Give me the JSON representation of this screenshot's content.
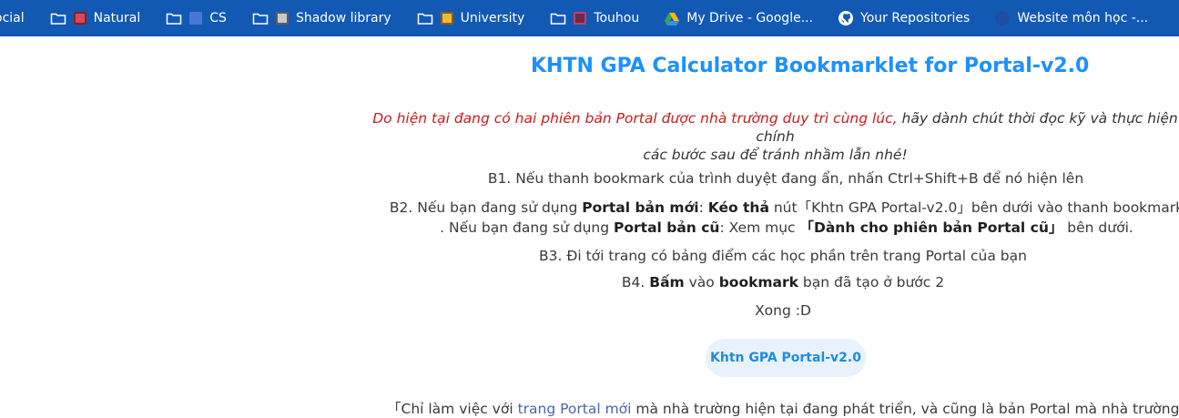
{
  "bookmarks": [
    {
      "label": "ocial",
      "icon": "none"
    },
    {
      "label": "Natural",
      "icon": "folder-icon"
    },
    {
      "label": "CS",
      "icon": "folder-icon"
    },
    {
      "label": "Shadow library",
      "icon": "folder-icon"
    },
    {
      "label": "University",
      "icon": "folder-icon"
    },
    {
      "label": "Touhou",
      "icon": "folder-icon"
    },
    {
      "label": "My Drive - Google...",
      "icon": "google-drive-icon"
    },
    {
      "label": "Your Repositories",
      "icon": "github-icon"
    },
    {
      "label": "Website môn học -...",
      "icon": "website-icon"
    }
  ],
  "page": {
    "title": "KHTN GPA Calculator Bookmarklet for Portal-v2.0",
    "notice_red": "Do hiện tại đang có hai phiên bản Portal được nhà trường duy trì cùng lúc,",
    "notice_rest": " hãy dành chút thời đọc kỹ và thực hiện chính",
    "notice_line2": "các bước sau để tránh nhầm lẫn nhé!",
    "step1": "B1. Nếu thanh bookmark của trình duyệt đang ẩn, nhấn Ctrl+Shift+B để nó hiện lên",
    "step2_prefix": "B2. Nếu bạn đang sử dụng ",
    "step2_bold1": "Portal bản mới",
    "step2_mid1": ": ",
    "step2_bold2": "Kéo thả",
    "step2_mid2": " nút「Khtn GPA Portal-v2.0」bên dưới vào thanh bookmark",
    "step2b_prefix": ". Nếu bạn đang sử dụng ",
    "step2b_bold1": "Portal bản cũ",
    "step2b_mid": ": Xem mục ",
    "step2b_bold2": "「Dành cho phiên bản Portal cũ」",
    "step2b_suffix": " bên dưới.",
    "step3": "B3. Đi tới trang có bảng điểm các học phần trên trang Portal của bạn",
    "step4_prefix": "B4. ",
    "step4_bold1": "Bấm",
    "step4_mid": " vào ",
    "step4_bold2": "bookmark",
    "step4_suffix": " bạn đã tạo ở bước 2",
    "done": "Xong :D",
    "button_label": "Khtn GPA Portal-v2.0",
    "footer_prefix": "「Chỉ làm việc với ",
    "footer_link": "trang Portal mới",
    "footer_suffix": " mà nhà trường hiện tại đang phát triển, và cũng là bản Portal mà nhà trường đan"
  },
  "colors": {
    "bookmarks_bar": "#1259b4",
    "title": "#1e90ff",
    "notice_red": "#cc1a1a",
    "button_bg": "#e8f2fc",
    "button_text": "#1e8be4",
    "link": "#4b66a8"
  }
}
